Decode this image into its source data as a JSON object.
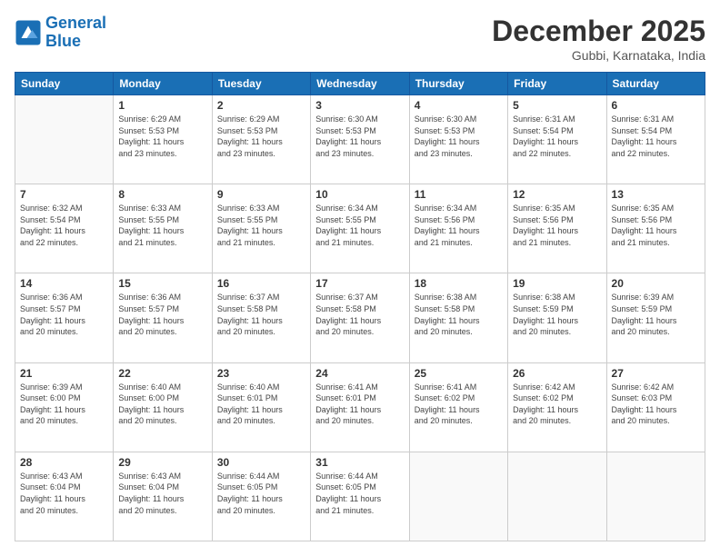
{
  "header": {
    "logo_line1": "General",
    "logo_line2": "Blue",
    "month": "December 2025",
    "location": "Gubbi, Karnataka, India"
  },
  "days_of_week": [
    "Sunday",
    "Monday",
    "Tuesday",
    "Wednesday",
    "Thursday",
    "Friday",
    "Saturday"
  ],
  "weeks": [
    [
      {
        "day": "",
        "info": ""
      },
      {
        "day": "1",
        "info": "Sunrise: 6:29 AM\nSunset: 5:53 PM\nDaylight: 11 hours\nand 23 minutes."
      },
      {
        "day": "2",
        "info": "Sunrise: 6:29 AM\nSunset: 5:53 PM\nDaylight: 11 hours\nand 23 minutes."
      },
      {
        "day": "3",
        "info": "Sunrise: 6:30 AM\nSunset: 5:53 PM\nDaylight: 11 hours\nand 23 minutes."
      },
      {
        "day": "4",
        "info": "Sunrise: 6:30 AM\nSunset: 5:53 PM\nDaylight: 11 hours\nand 23 minutes."
      },
      {
        "day": "5",
        "info": "Sunrise: 6:31 AM\nSunset: 5:54 PM\nDaylight: 11 hours\nand 22 minutes."
      },
      {
        "day": "6",
        "info": "Sunrise: 6:31 AM\nSunset: 5:54 PM\nDaylight: 11 hours\nand 22 minutes."
      }
    ],
    [
      {
        "day": "7",
        "info": "Sunrise: 6:32 AM\nSunset: 5:54 PM\nDaylight: 11 hours\nand 22 minutes."
      },
      {
        "day": "8",
        "info": "Sunrise: 6:33 AM\nSunset: 5:55 PM\nDaylight: 11 hours\nand 21 minutes."
      },
      {
        "day": "9",
        "info": "Sunrise: 6:33 AM\nSunset: 5:55 PM\nDaylight: 11 hours\nand 21 minutes."
      },
      {
        "day": "10",
        "info": "Sunrise: 6:34 AM\nSunset: 5:55 PM\nDaylight: 11 hours\nand 21 minutes."
      },
      {
        "day": "11",
        "info": "Sunrise: 6:34 AM\nSunset: 5:56 PM\nDaylight: 11 hours\nand 21 minutes."
      },
      {
        "day": "12",
        "info": "Sunrise: 6:35 AM\nSunset: 5:56 PM\nDaylight: 11 hours\nand 21 minutes."
      },
      {
        "day": "13",
        "info": "Sunrise: 6:35 AM\nSunset: 5:56 PM\nDaylight: 11 hours\nand 21 minutes."
      }
    ],
    [
      {
        "day": "14",
        "info": "Sunrise: 6:36 AM\nSunset: 5:57 PM\nDaylight: 11 hours\nand 20 minutes."
      },
      {
        "day": "15",
        "info": "Sunrise: 6:36 AM\nSunset: 5:57 PM\nDaylight: 11 hours\nand 20 minutes."
      },
      {
        "day": "16",
        "info": "Sunrise: 6:37 AM\nSunset: 5:58 PM\nDaylight: 11 hours\nand 20 minutes."
      },
      {
        "day": "17",
        "info": "Sunrise: 6:37 AM\nSunset: 5:58 PM\nDaylight: 11 hours\nand 20 minutes."
      },
      {
        "day": "18",
        "info": "Sunrise: 6:38 AM\nSunset: 5:58 PM\nDaylight: 11 hours\nand 20 minutes."
      },
      {
        "day": "19",
        "info": "Sunrise: 6:38 AM\nSunset: 5:59 PM\nDaylight: 11 hours\nand 20 minutes."
      },
      {
        "day": "20",
        "info": "Sunrise: 6:39 AM\nSunset: 5:59 PM\nDaylight: 11 hours\nand 20 minutes."
      }
    ],
    [
      {
        "day": "21",
        "info": "Sunrise: 6:39 AM\nSunset: 6:00 PM\nDaylight: 11 hours\nand 20 minutes."
      },
      {
        "day": "22",
        "info": "Sunrise: 6:40 AM\nSunset: 6:00 PM\nDaylight: 11 hours\nand 20 minutes."
      },
      {
        "day": "23",
        "info": "Sunrise: 6:40 AM\nSunset: 6:01 PM\nDaylight: 11 hours\nand 20 minutes."
      },
      {
        "day": "24",
        "info": "Sunrise: 6:41 AM\nSunset: 6:01 PM\nDaylight: 11 hours\nand 20 minutes."
      },
      {
        "day": "25",
        "info": "Sunrise: 6:41 AM\nSunset: 6:02 PM\nDaylight: 11 hours\nand 20 minutes."
      },
      {
        "day": "26",
        "info": "Sunrise: 6:42 AM\nSunset: 6:02 PM\nDaylight: 11 hours\nand 20 minutes."
      },
      {
        "day": "27",
        "info": "Sunrise: 6:42 AM\nSunset: 6:03 PM\nDaylight: 11 hours\nand 20 minutes."
      }
    ],
    [
      {
        "day": "28",
        "info": "Sunrise: 6:43 AM\nSunset: 6:04 PM\nDaylight: 11 hours\nand 20 minutes."
      },
      {
        "day": "29",
        "info": "Sunrise: 6:43 AM\nSunset: 6:04 PM\nDaylight: 11 hours\nand 20 minutes."
      },
      {
        "day": "30",
        "info": "Sunrise: 6:44 AM\nSunset: 6:05 PM\nDaylight: 11 hours\nand 20 minutes."
      },
      {
        "day": "31",
        "info": "Sunrise: 6:44 AM\nSunset: 6:05 PM\nDaylight: 11 hours\nand 21 minutes."
      },
      {
        "day": "",
        "info": ""
      },
      {
        "day": "",
        "info": ""
      },
      {
        "day": "",
        "info": ""
      }
    ]
  ]
}
